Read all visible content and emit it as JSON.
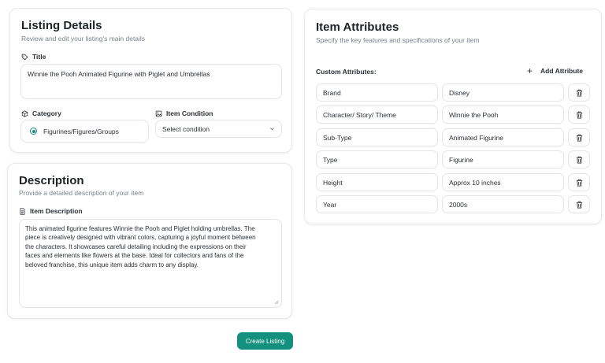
{
  "listing": {
    "title": "Listing Details",
    "subtitle": "Review and edit your listing's main details",
    "title_label": "Title",
    "title_value": "Winnie the Pooh Animated Figurine with Piglet and Umbrellas",
    "category_label": "Category",
    "category_value": "Figurines/Figures/Groups",
    "condition_label": "Item Condition",
    "condition_placeholder": "Select condition"
  },
  "description": {
    "title": "Description",
    "subtitle": "Provide a detailed description of your item",
    "field_label": "Item Description",
    "lines": [
      "This animated figurine features Winnie the Pooh and Piglet holding umbrellas. The",
      "piece is creatively designed with vibrant colors, capturing a joyful moment between",
      "the characters. It showcases careful detailing including the expressions on their",
      "faces and elements like flowers at the base. Ideal for collectors and fans of the",
      "beloved franchise, this unique item adds charm to any display."
    ]
  },
  "attributes": {
    "title": "Item Attributes",
    "subtitle": "Specify the key features and specifications of your item",
    "custom_label": "Custom Attributes:",
    "add_label": "Add Attribute",
    "rows": [
      {
        "key": "Brand",
        "value": "Disney"
      },
      {
        "key": "Character/ Story/ Theme",
        "value": "Winnie the Pooh"
      },
      {
        "key": "Sub-Type",
        "value": "Animated Figurine"
      },
      {
        "key": "Type",
        "value": "Figurine"
      },
      {
        "key": "Height",
        "value": "Approx 10 inches"
      },
      {
        "key": "Year",
        "value": "2000s"
      }
    ]
  },
  "actions": {
    "create_label": "Create Listing"
  },
  "colors": {
    "accent": "#14907e",
    "border": "#e3e5e8",
    "muted": "#7a808a"
  },
  "icons": {
    "title": "tag-icon",
    "category": "cube-icon",
    "condition": "image-icon",
    "description": "document-icon",
    "add": "plus-icon",
    "delete": "trash-icon",
    "select": "chevron-down-icon"
  }
}
